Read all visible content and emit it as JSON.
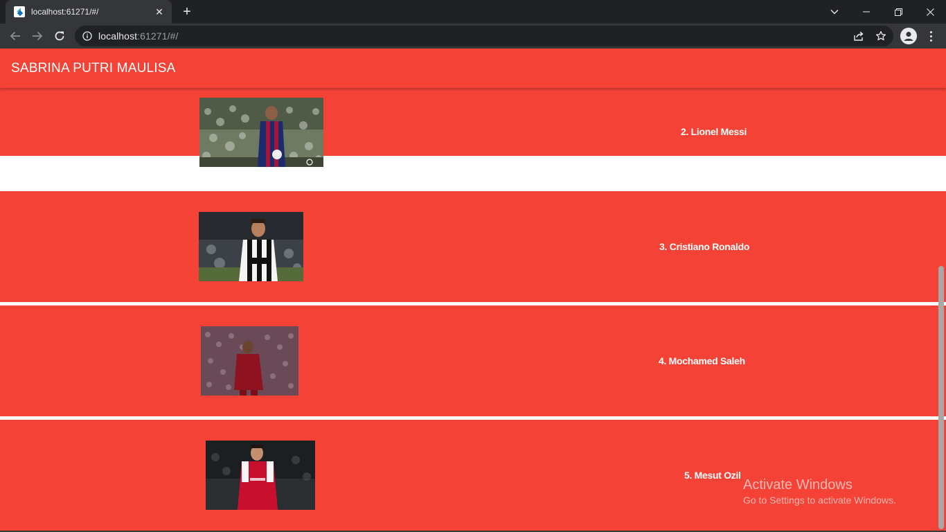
{
  "browser": {
    "tab_title": "localhost:61271/#/",
    "close_glyph": "✕",
    "new_tab_glyph": "+",
    "url_host": "localhost",
    "url_rest": ":61271/#/"
  },
  "app": {
    "title": "SABRINA PUTRI MAULISA"
  },
  "players": [
    {
      "label": "2. Lionel Messi",
      "photo": "messi-photo",
      "kit": "barcelona"
    },
    {
      "label": "3. Cristiano Ronaldo",
      "photo": "ronaldo-photo",
      "kit": "juventus"
    },
    {
      "label": "4. Mochamed Saleh",
      "photo": "salah-photo",
      "kit": "liverpool"
    },
    {
      "label": "5. Mesut Ozil",
      "photo": "ozil-photo",
      "kit": "arsenal"
    }
  ],
  "watermark": {
    "title": "Activate Windows",
    "subtitle": "Go to Settings to activate Windows."
  },
  "colors": {
    "app_bar": "#f44336",
    "row_background": "#f44336",
    "divider": "#ffffff",
    "text": "#ffffff"
  },
  "icons": [
    "flutter-favicon-icon",
    "close-icon",
    "plus-icon",
    "chevron-down-icon",
    "minimize-icon",
    "restore-icon",
    "close-window-icon",
    "back-arrow-icon",
    "forward-arrow-icon",
    "reload-icon",
    "info-icon",
    "share-icon",
    "star-icon",
    "profile-icon",
    "more-vert-icon"
  ]
}
